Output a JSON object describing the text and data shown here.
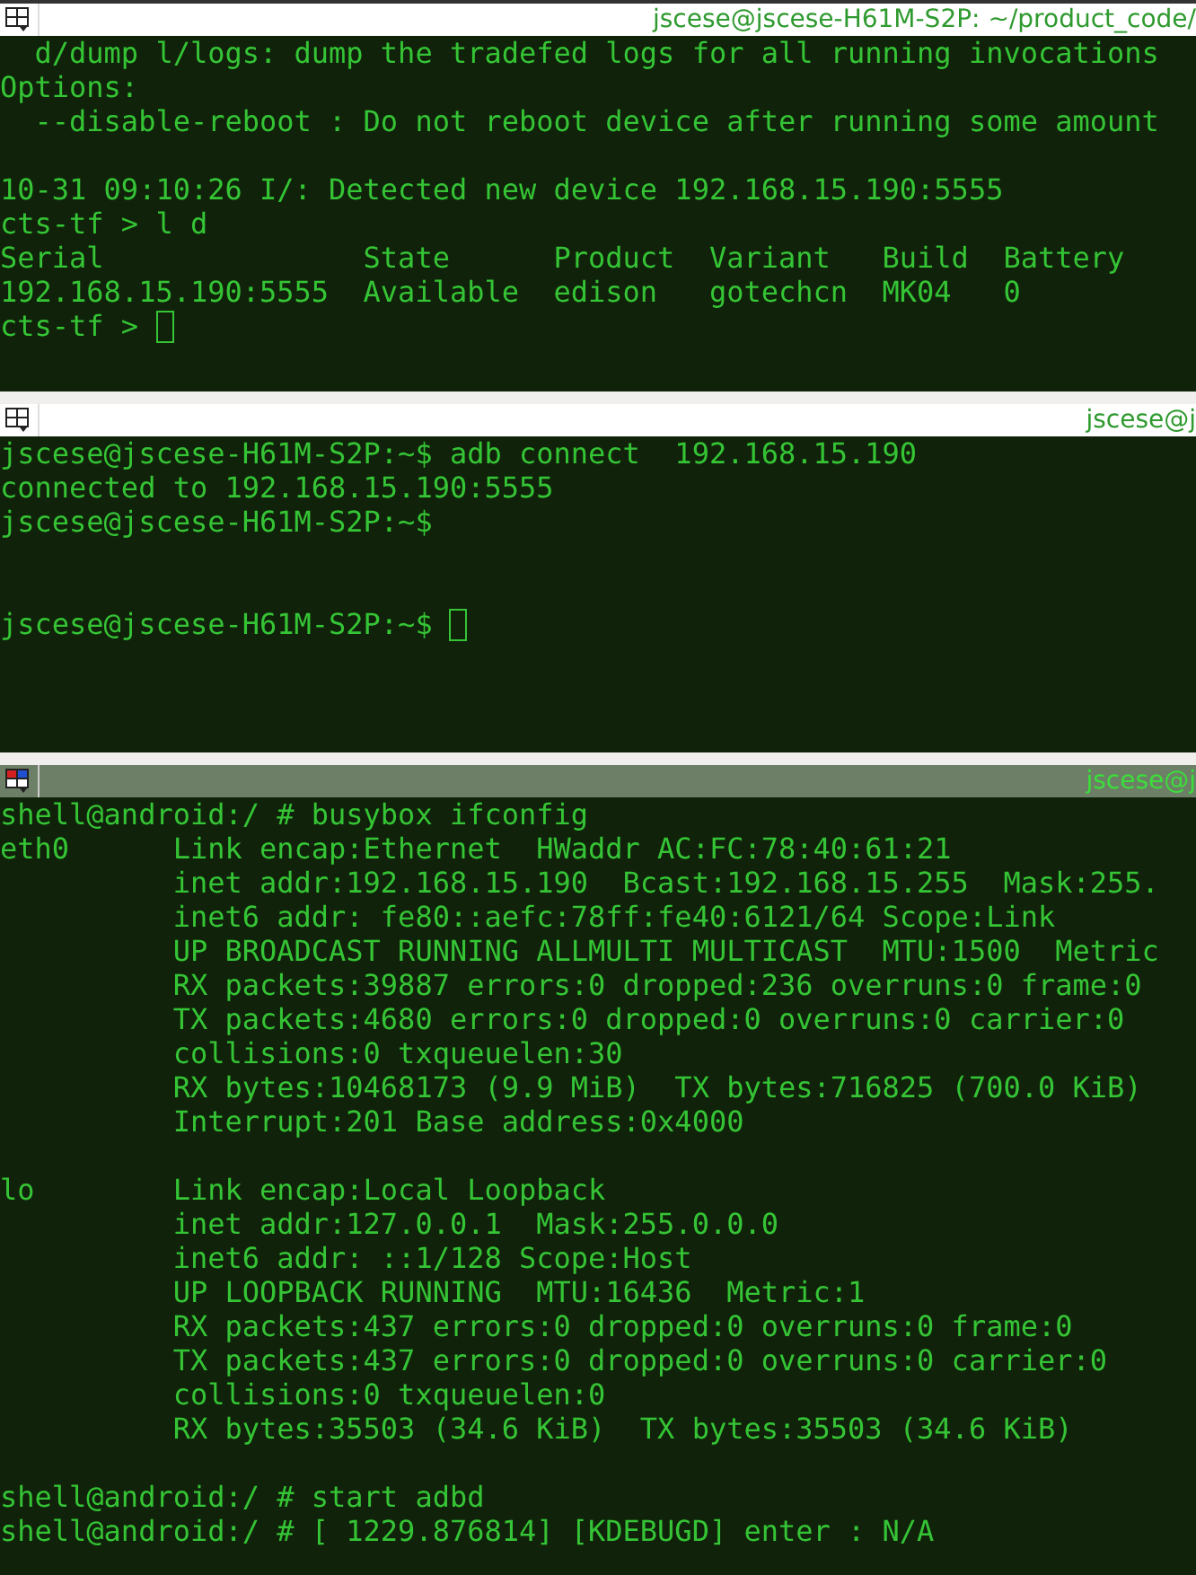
{
  "panes": [
    {
      "title": "jscese@jscese-H61M-S2P: ~/product_code/",
      "active": false,
      "lines": [
        {
          "kind": "text",
          "text": "  d/dump l/logs: dump the tradefed logs for all running invocations"
        },
        {
          "kind": "text",
          "text": "Options:"
        },
        {
          "kind": "text",
          "text": "  --disable-reboot : Do not reboot device after running some amount"
        },
        {
          "kind": "blank"
        },
        {
          "kind": "text",
          "text": "10-31 09:10:26 I/: Detected new device 192.168.15.190:5555"
        },
        {
          "kind": "text",
          "text": "cts-tf > l d"
        },
        {
          "kind": "text",
          "text": "Serial               State      Product  Variant   Build  Battery"
        },
        {
          "kind": "text",
          "text": "192.168.15.190:5555  Available  edison   gotechcn  MK04   0"
        },
        {
          "kind": "prompt",
          "text": "cts-tf > "
        }
      ]
    },
    {
      "title": "jscese@j",
      "active": false,
      "lines": [
        {
          "kind": "text",
          "text": "jscese@jscese-H61M-S2P:~$ adb connect  192.168.15.190"
        },
        {
          "kind": "text",
          "text": "connected to 192.168.15.190:5555"
        },
        {
          "kind": "text",
          "text": "jscese@jscese-H61M-S2P:~$"
        },
        {
          "kind": "blank"
        },
        {
          "kind": "blank"
        },
        {
          "kind": "prompt",
          "text": "jscese@jscese-H61M-S2P:~$ "
        }
      ]
    },
    {
      "title": "jscese@j",
      "active": true,
      "lines": [
        {
          "kind": "text",
          "text": "shell@android:/ # busybox ifconfig"
        },
        {
          "kind": "text",
          "text": "eth0      Link encap:Ethernet  HWaddr AC:FC:78:40:61:21"
        },
        {
          "kind": "text",
          "text": "          inet addr:192.168.15.190  Bcast:192.168.15.255  Mask:255."
        },
        {
          "kind": "text",
          "text": "          inet6 addr: fe80::aefc:78ff:fe40:6121/64 Scope:Link"
        },
        {
          "kind": "text",
          "text": "          UP BROADCAST RUNNING ALLMULTI MULTICAST  MTU:1500  Metric"
        },
        {
          "kind": "text",
          "text": "          RX packets:39887 errors:0 dropped:236 overruns:0 frame:0"
        },
        {
          "kind": "text",
          "text": "          TX packets:4680 errors:0 dropped:0 overruns:0 carrier:0"
        },
        {
          "kind": "text",
          "text": "          collisions:0 txqueuelen:30"
        },
        {
          "kind": "text",
          "text": "          RX bytes:10468173 (9.9 MiB)  TX bytes:716825 (700.0 KiB)"
        },
        {
          "kind": "text",
          "text": "          Interrupt:201 Base address:0x4000"
        },
        {
          "kind": "blank"
        },
        {
          "kind": "text",
          "text": "lo        Link encap:Local Loopback"
        },
        {
          "kind": "text",
          "text": "          inet addr:127.0.0.1  Mask:255.0.0.0"
        },
        {
          "kind": "text",
          "text": "          inet6 addr: ::1/128 Scope:Host"
        },
        {
          "kind": "text",
          "text": "          UP LOOPBACK RUNNING  MTU:16436  Metric:1"
        },
        {
          "kind": "text",
          "text": "          RX packets:437 errors:0 dropped:0 overruns:0 frame:0"
        },
        {
          "kind": "text",
          "text": "          TX packets:437 errors:0 dropped:0 overruns:0 carrier:0"
        },
        {
          "kind": "text",
          "text": "          collisions:0 txqueuelen:0"
        },
        {
          "kind": "text",
          "text": "          RX bytes:35503 (34.6 KiB)  TX bytes:35503 (34.6 KiB)"
        },
        {
          "kind": "blank"
        },
        {
          "kind": "text",
          "text": "shell@android:/ # start adbd"
        },
        {
          "kind": "text",
          "text": "shell@android:/ # [ 1229.876814] [KDEBUGD] enter : N/A"
        }
      ]
    }
  ]
}
